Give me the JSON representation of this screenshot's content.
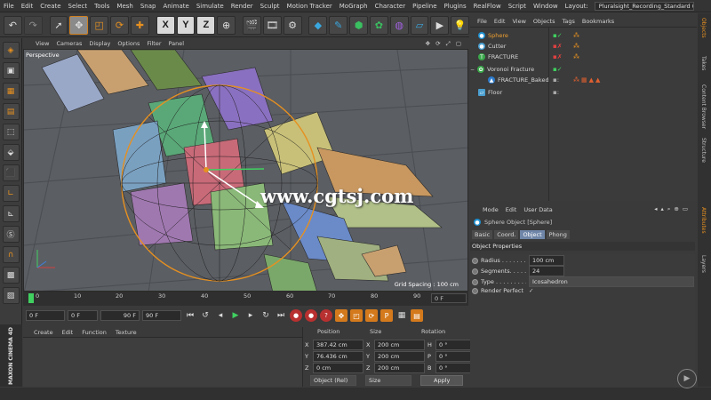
{
  "menu": [
    "File",
    "Edit",
    "Create",
    "Select",
    "Tools",
    "Mesh",
    "Snap",
    "Animate",
    "Simulate",
    "Render",
    "Sculpt",
    "Motion Tracker",
    "MoGraph",
    "Character",
    "Pipeline",
    "Plugins",
    "RealFlow",
    "Script",
    "Window"
  ],
  "layout": {
    "label": "Layout:",
    "value": "Pluralsight_Recording_Standard (User)"
  },
  "toolbar": {
    "x": "X",
    "y": "Y",
    "z": "Z"
  },
  "viewport": {
    "menu": [
      "View",
      "Cameras",
      "Display",
      "Options",
      "Filter",
      "Panel"
    ],
    "nav_icons": "✥ ⟳ ⤢ ▢",
    "label": "Perspective",
    "grid_spacing": "Grid Spacing : 100 cm",
    "watermark": "www.cgtsj.com"
  },
  "timeline": {
    "ticks": [
      "0",
      "10",
      "20",
      "30",
      "40",
      "50",
      "60",
      "70",
      "80",
      "90"
    ],
    "current_frame": "0 F"
  },
  "transport": {
    "start": "0 F",
    "range_start": "0 F",
    "range_end": "90 F",
    "end": "90 F"
  },
  "material": {
    "menu": [
      "Create",
      "Edit",
      "Function",
      "Texture"
    ],
    "logo": "MAXON CINEMA 4D"
  },
  "coords": {
    "headers": [
      "Position",
      "Size",
      "Rotation"
    ],
    "rows": [
      {
        "axis": "X",
        "pos": "387.42 cm",
        "size_axis": "X",
        "size": "200 cm",
        "rot_axis": "H",
        "rot": "0 °"
      },
      {
        "axis": "Y",
        "pos": "76.436 cm",
        "size_axis": "Y",
        "size": "200 cm",
        "rot_axis": "P",
        "rot": "0 °"
      },
      {
        "axis": "Z",
        "pos": "0 cm",
        "size_axis": "Z",
        "size": "200 cm",
        "rot_axis": "B",
        "rot": "0 °"
      }
    ],
    "mode": "Object (Rel)",
    "size_mode": "Size",
    "apply": "Apply"
  },
  "objects": {
    "menu": [
      "File",
      "Edit",
      "View",
      "Objects",
      "Tags",
      "Bookmarks"
    ],
    "items": [
      {
        "name": "Sphere",
        "color": "#1e90d0",
        "active": true
      },
      {
        "name": "Cutter",
        "color": "#4a9fd0",
        "active": false
      },
      {
        "name": "FRACTURE",
        "color": "#3aa84a",
        "active": false
      },
      {
        "name": "Voronoi Fracture",
        "color": "#3aa84a",
        "active": false
      },
      {
        "name": "FRACTURE_Baked",
        "color": "#2c7acc",
        "active": false
      },
      {
        "name": "Floor",
        "color": "#4a9fd0",
        "active": false
      }
    ]
  },
  "attributes": {
    "menu": [
      "Mode",
      "Edit",
      "User Data"
    ],
    "title": "Sphere Object [Sphere]",
    "tabs": [
      "Basic",
      "Coord.",
      "Object",
      "Phong"
    ],
    "active_tab": "Object",
    "section": "Object Properties",
    "radius_label": "Radius . . . . . . .",
    "radius": "100 cm",
    "segments_label": "Segments. . . . .",
    "segments": "24",
    "type_label": "Type . . . . . . . . .",
    "type": "Icosahedron",
    "render_perfect_label": "Render Perfect",
    "render_perfect": "✓"
  },
  "side_tabs": [
    "Objects",
    "Takes",
    "Content Browser",
    "Structure",
    "Attributes",
    "Layers"
  ]
}
